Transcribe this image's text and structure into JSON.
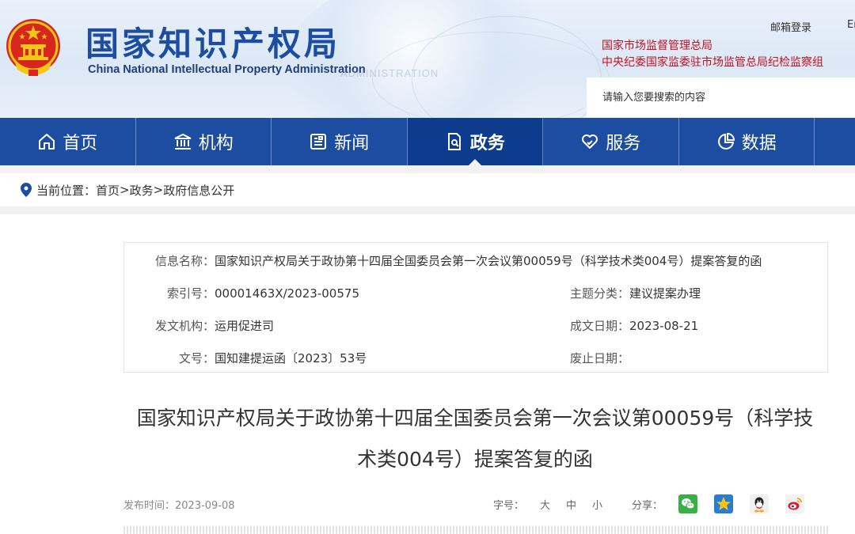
{
  "header": {
    "title_cn": "国家知识产权局",
    "title_en": "China National Intellectual Property Administration",
    "watermark": "ADMINISTRATION",
    "login_label": "邮箱登录",
    "lang_label": "En",
    "dept_links": [
      "国家市场监督管理总局",
      "中央纪委国家监委驻市场监管总局纪检监察组"
    ],
    "search_placeholder": "请输入您要搜索的内容"
  },
  "nav": {
    "items": [
      {
        "label": "首页",
        "icon": "home-icon"
      },
      {
        "label": "机构",
        "icon": "institution-icon"
      },
      {
        "label": "新闻",
        "icon": "news-icon"
      },
      {
        "label": "政务",
        "icon": "government-affairs-icon",
        "active": true
      },
      {
        "label": "服务",
        "icon": "service-icon"
      },
      {
        "label": "数据",
        "icon": "data-pie-icon"
      }
    ]
  },
  "breadcrumb": {
    "prefix": "当前位置：",
    "items": [
      "首页",
      "政务",
      "政府信息公开"
    ],
    "separator": ">"
  },
  "info": {
    "name_label": "信息名称：",
    "name_value": "国家知识产权局关于政协第十四届全国委员会第一次会议第00059号（科学技术类004号）提案答复的函",
    "index_label": "索引号：",
    "index_value": "00001463X/2023-00575",
    "topic_label": "主题分类：",
    "topic_value": "建议提案办理",
    "org_label": "发文机构：",
    "org_value": "运用促进司",
    "date_label": "成文日期：",
    "date_value": "2023-08-21",
    "docno_label": "文号：",
    "docno_value": "国知建提运函〔2023〕53号",
    "abolish_label": "废止日期：",
    "abolish_value": ""
  },
  "article": {
    "title_line1": "国家知识产权局关于政协第十四届全国委员会第一次会议第00059号（科学技",
    "title_line2": "术类004号）提案答复的函",
    "publish_label": "发布时间：",
    "publish_date": "2023-09-08",
    "font_size_label": "字号：",
    "font_sizes": [
      "大",
      "中",
      "小"
    ],
    "share_label": "分享：",
    "share_targets": [
      "wechat-icon",
      "qzone-icon",
      "qq-icon",
      "weibo-icon"
    ]
  },
  "colors": {
    "primary_blue": "#1c4da1",
    "nav_active": "#0d3c8e",
    "accent_red": "#c8102e",
    "dept_link_red": "#c0121f"
  }
}
